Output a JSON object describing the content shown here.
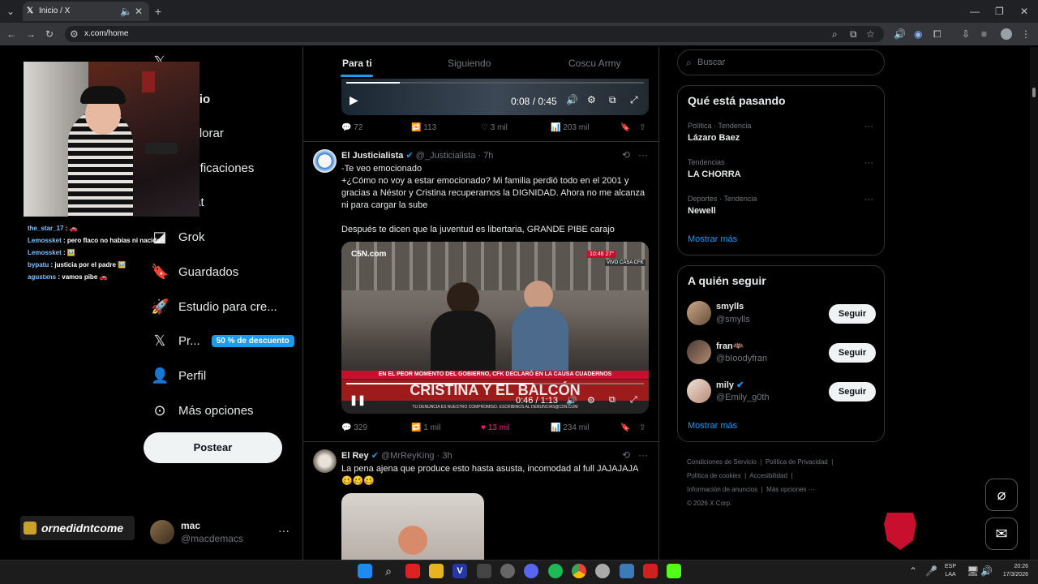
{
  "browser": {
    "tab_title": "Inicio / X",
    "url": "x.com/home"
  },
  "stream_overlay": {
    "chat": [
      {
        "user": "the_star_17",
        "msg": ": 🚗"
      },
      {
        "user": "Lemossket",
        "msg": ": pero flaco no habías ni nacido"
      },
      {
        "user": "Lemossket",
        "msg": ": 🖼️"
      },
      {
        "user": "bypatu",
        "msg": ": justicia por el padre 🖼️"
      },
      {
        "user": "agustxns",
        "msg": ": vamos pibe 🚗"
      }
    ],
    "channel_logo": "ornedidntcome"
  },
  "sidebar": {
    "items": [
      {
        "icon": "x-logo-icon",
        "label": ""
      },
      {
        "icon": "home-icon",
        "label": "Inicio"
      },
      {
        "icon": "search-icon",
        "label": "Explorar"
      },
      {
        "icon": "bell-icon",
        "label": "Notificaciones"
      },
      {
        "icon": "mail-icon",
        "label": "Chat"
      },
      {
        "icon": "grok-icon",
        "label": "Grok"
      },
      {
        "icon": "bookmark-icon",
        "label": "Guardados"
      },
      {
        "icon": "rocket-icon",
        "label": "Estudio para cre..."
      },
      {
        "icon": "x-icon",
        "label": "Pr..."
      },
      {
        "icon": "person-icon",
        "label": "Perfil"
      },
      {
        "icon": "more-circle-icon",
        "label": "Más opciones"
      }
    ],
    "premium_badge": "50 % de descuento",
    "post_button": "Postear",
    "account": {
      "name": "mac",
      "handle": "@macdemacs",
      "more": "···"
    }
  },
  "feed": {
    "tabs": [
      "Para ti",
      "Siguiendo",
      "Coscu Army"
    ],
    "active_tab": 0,
    "top_video": {
      "time": "0:08 / 0:45",
      "progress": 0.18
    },
    "top_actions": {
      "replies": "72",
      "reposts": "113",
      "likes": "3 mil",
      "views": "203 mil"
    },
    "posts": [
      {
        "name": "El Justicialista",
        "handle": "@_Justicialista",
        "time": "· 7h",
        "text_lines": [
          "-Te veo emocionado",
          "+¿Cómo no voy a estar emocionado? Mi familia perdió todo en el 2001 y",
          "gracias a Néstor y Cristina recuperamos la DIGNIDAD. Ahora no me alcanza",
          "ni para cargar la sube",
          "",
          "Después te dicen que la juventud es libertaria, GRANDE PIBE carajo"
        ],
        "video": {
          "watermark": "C5N.com",
          "clock": "10:46 27°",
          "live": "VIVO CASA CFK",
          "lower_third": "EN EL PEOR MOMENTO DEL GOBIERNO, CFK DECLARÓ EN LA CAUSA CUADERNOS",
          "headline": "CRISTINA Y EL BALCÓN",
          "ticker": "TU DENUNCIA ES NUESTRO COMPROMISO. ESCRIBINOS AL DENUNCIAS@C5N.COM",
          "time": "0:46 / 1:13",
          "progress": 0.63
        },
        "actions": {
          "replies": "329",
          "reposts": "1 mil",
          "likes": "13 mil",
          "views": "234 mil"
        }
      },
      {
        "name": "El Rey",
        "handle": "@MrReyKing",
        "time": "· 3h",
        "text_lines": [
          "La pena ajena que produce esto hasta asusta, incomodad al full JAJAJAJA",
          "🥴🥴🥴"
        ]
      }
    ]
  },
  "right": {
    "search_placeholder": "Buscar",
    "trends_title": "Qué está pasando",
    "trends": [
      {
        "context": "Política · Tendencia",
        "name": "Lázaro Baez"
      },
      {
        "context": "Tendencias",
        "name": "LA CHORRA"
      },
      {
        "context": "Deportes · Tendencia",
        "name": "Newell"
      }
    ],
    "show_more": "Mostrar más",
    "follow_title": "A quién seguir",
    "follow": [
      {
        "name": "smylls",
        "handle": "@smylls",
        "button": "Seguir"
      },
      {
        "name": "fran🦇",
        "handle": "@bIoodyfran",
        "button": "Seguir"
      },
      {
        "name": "mily",
        "handle": "@Emily_g0th",
        "button": "Seguir"
      }
    ],
    "show_more_2": "Mostrar más",
    "footer": [
      "Condiciones de Servicio",
      "|",
      "Política de Privacidad",
      "|",
      "Política de cookies",
      "|",
      "Accesibilidad",
      "|",
      "Información de anuncios",
      "|",
      "Más opciones ···",
      "© 2026 X Corp."
    ]
  },
  "taskbar": {
    "lang_top": "ESP",
    "lang_bottom": "LAA",
    "time": "20:26",
    "date": "17/3/2026"
  },
  "colors": {
    "accent": "#1d9bf0",
    "like": "#f91880",
    "badge": "#1d9bf0"
  }
}
